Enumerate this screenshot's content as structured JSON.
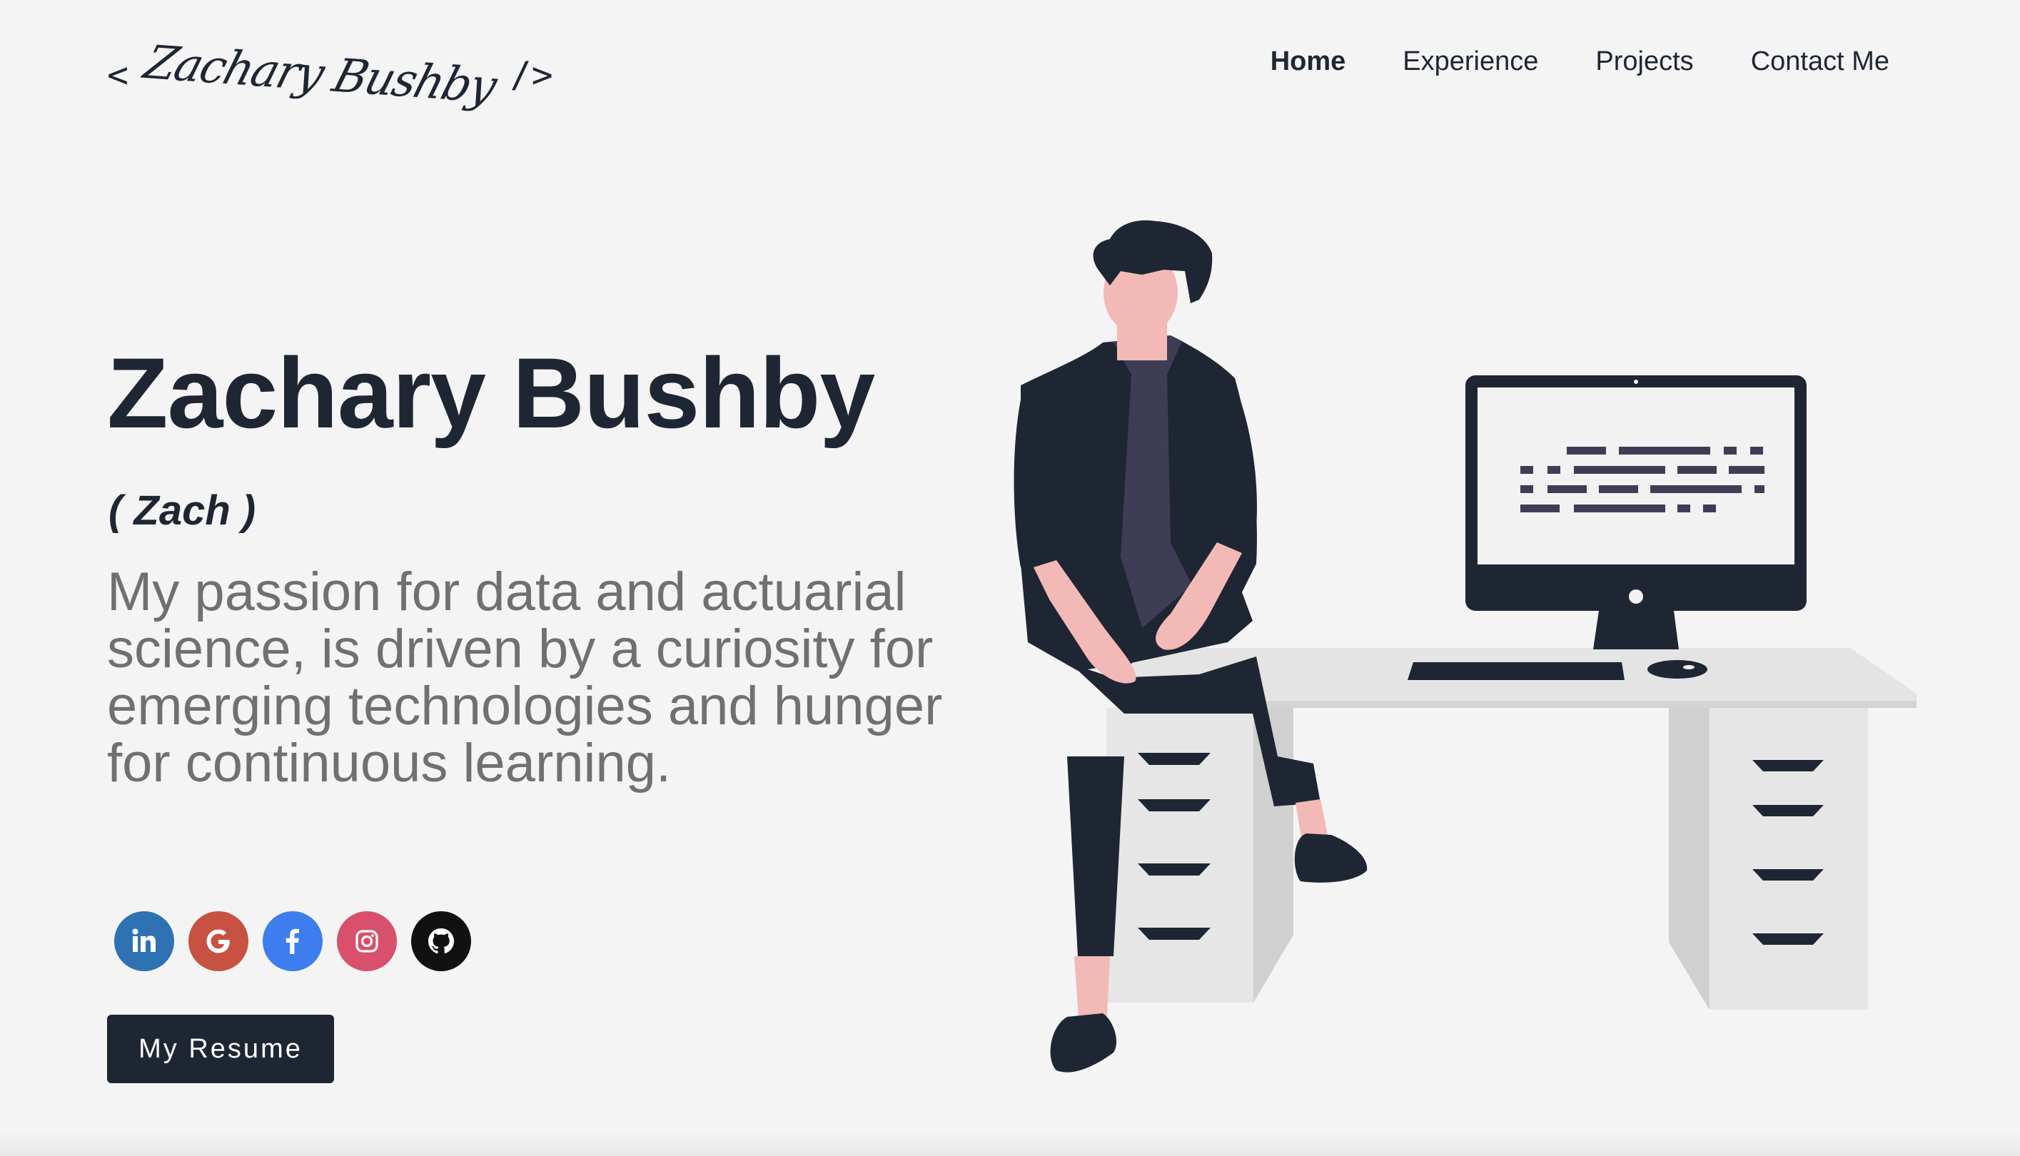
{
  "header": {
    "logo": {
      "open_bracket": "<",
      "signature": "Zachary Bushby",
      "close_bracket": "/>"
    },
    "nav": [
      {
        "label": "Home",
        "active": true
      },
      {
        "label": "Experience",
        "active": false
      },
      {
        "label": "Projects",
        "active": false
      },
      {
        "label": "Contact Me",
        "active": false
      }
    ]
  },
  "hero": {
    "name": "Zachary Bushby",
    "nickname": "( Zach )",
    "tagline": "My passion for data and actuarial science, is driven by a curiosity for emerging technologies and hunger for continuous learning.",
    "resume_button": "My Resume"
  },
  "socials": [
    {
      "name": "linkedin-icon",
      "color": "#2f72b4"
    },
    {
      "name": "google-icon",
      "color": "#c75241"
    },
    {
      "name": "facebook-icon",
      "color": "#3d7ded"
    },
    {
      "name": "instagram-icon",
      "color": "#d8506b"
    },
    {
      "name": "github-icon",
      "color": "#111111"
    }
  ],
  "colors": {
    "background": "#f4f4f4",
    "primary": "#1f2633",
    "tagline": "#707070",
    "skin": "#f2b9b6",
    "shirt": "#3f3d56",
    "desk": "#e6e6e6"
  }
}
